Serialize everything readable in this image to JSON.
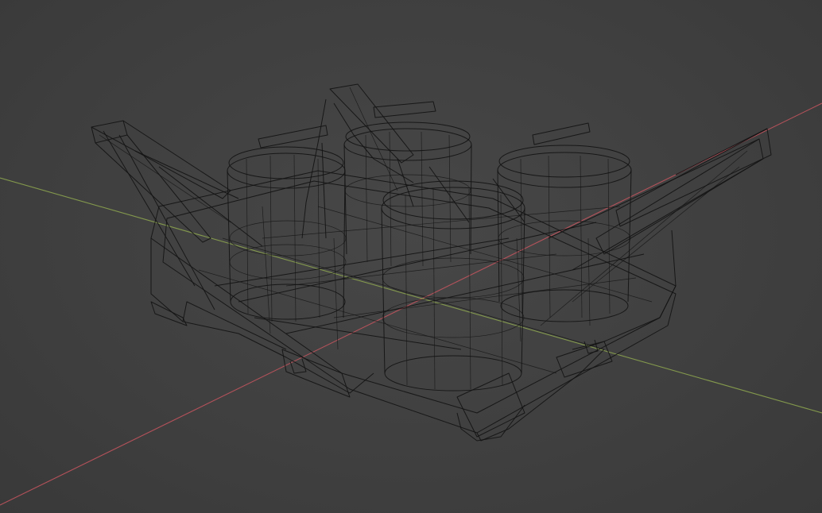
{
  "viewport": {
    "background_color": "#404040",
    "wire_color": "#141414",
    "axis_x_color": "#c8555f",
    "axis_y_color": "#8fa84f",
    "display_mode": "wireframe"
  }
}
